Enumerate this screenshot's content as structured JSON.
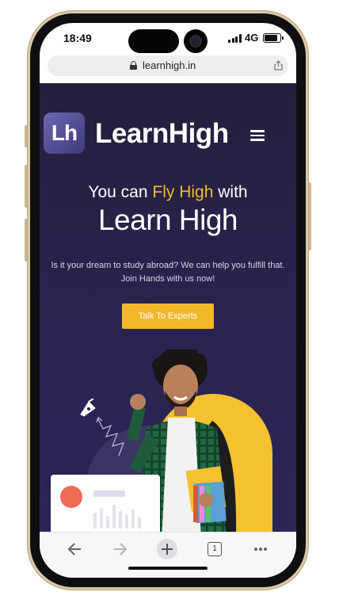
{
  "status_bar": {
    "time": "18:49",
    "network": "4G",
    "icons": [
      "signal-icon",
      "battery-icon"
    ]
  },
  "browser": {
    "url": "learnhigh.in",
    "icons": [
      "lock-icon",
      "share-icon"
    ]
  },
  "site": {
    "logo_text": "Lh",
    "brand_name": "LearnHigh",
    "menu_icon": "hamburger-menu-icon",
    "headline_prefix": "You can ",
    "headline_highlight": "Fly High",
    "headline_suffix": " with",
    "headline_main": "Learn High",
    "subtext": "Is it your dream to study abroad? We can help you fulfill that. Join Hands with us now!",
    "cta_label": "Talk To Experts",
    "colors": {
      "accent": "#f3b82a",
      "background": "#27214a",
      "card_dot": "#ef6a55"
    }
  },
  "toolbar": {
    "tab_count": "1",
    "icons": [
      "back-arrow-icon",
      "forward-arrow-icon",
      "new-tab-plus-icon",
      "tabs-icon",
      "more-icon"
    ]
  }
}
